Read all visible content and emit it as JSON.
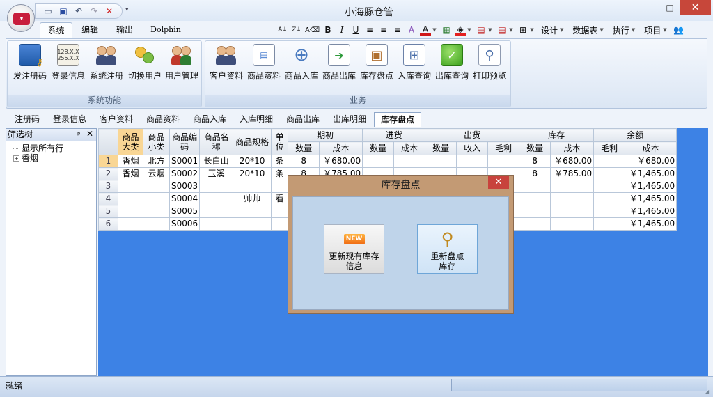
{
  "window": {
    "title": "小海豚仓管",
    "minimize": "–",
    "maximize": "□",
    "close": "✕"
  },
  "qat": {
    "items": [
      "monitor-icon",
      "save-icon",
      "undo-icon",
      "redo-icon",
      "delete-icon"
    ]
  },
  "ribbon_tabs": [
    {
      "label": "系统",
      "active": true
    },
    {
      "label": "编辑",
      "active": false
    },
    {
      "label": "输出",
      "active": false
    },
    {
      "label": "Dolphin",
      "active": false
    }
  ],
  "format_toolbar": {
    "menus": [
      "设计",
      "数据表",
      "执行",
      "项目"
    ]
  },
  "ribbon_groups": [
    {
      "label": "系统功能",
      "buttons": [
        "发注册码",
        "登录信息",
        "系统注册",
        "切换用户",
        "用户管理"
      ]
    },
    {
      "label": "业务",
      "buttons": [
        "客户资料",
        "商品资料",
        "商品入库",
        "商品出库",
        "库存盘点",
        "入库查询",
        "出库查询",
        "打印预览"
      ]
    }
  ],
  "doc_tabs": [
    {
      "label": "注册码",
      "active": false
    },
    {
      "label": "登录信息",
      "active": false
    },
    {
      "label": "客户资料",
      "active": false
    },
    {
      "label": "商品资料",
      "active": false
    },
    {
      "label": "商品入库",
      "active": false
    },
    {
      "label": "入库明细",
      "active": false
    },
    {
      "label": "商品出库",
      "active": false
    },
    {
      "label": "出库明细",
      "active": false
    },
    {
      "label": "库存盘点",
      "active": true
    }
  ],
  "filter_panel": {
    "title": "筛选树",
    "pin": "ᵖ",
    "close": "✕",
    "items": [
      {
        "label": "显示所有行",
        "expandable": false
      },
      {
        "label": "香烟",
        "expandable": true
      }
    ]
  },
  "grid": {
    "group_headers": [
      "期初",
      "进货",
      "出货",
      "库存",
      "余额"
    ],
    "fixed_headers": [
      "商品大类",
      "商品小类",
      "商品编码",
      "商品名称",
      "商品规格",
      "单位"
    ],
    "sub_headers": [
      "数量",
      "成本",
      "数量",
      "成本",
      "数量",
      "收入",
      "毛利",
      "数量",
      "成本",
      "毛利",
      "成本"
    ],
    "rows": [
      {
        "n": "1",
        "big": "香烟",
        "small": "北方",
        "code": "S0001",
        "name": "长白山",
        "spec": "20*10",
        "unit": "条",
        "q0": "8",
        "c0": "￥680.00",
        "q1": "",
        "c1": "",
        "q2": "",
        "inc": "",
        "gp": "",
        "q3": "8",
        "c3": "￥680.00",
        "gp2": "",
        "bal": "￥680.00"
      },
      {
        "n": "2",
        "big": "香烟",
        "small": "云烟",
        "code": "S0002",
        "name": "玉溪",
        "spec": "20*10",
        "unit": "条",
        "q0": "8",
        "c0": "￥785.00",
        "q1": "",
        "c1": "",
        "q2": "",
        "inc": "",
        "gp": "",
        "q3": "8",
        "c3": "￥785.00",
        "gp2": "",
        "bal": "￥1,465.00"
      },
      {
        "n": "3",
        "big": "",
        "small": "",
        "code": "S0003",
        "name": "",
        "spec": "",
        "unit": "",
        "q0": "",
        "c0": "",
        "q1": "",
        "c1": "",
        "q2": "",
        "inc": "",
        "gp": "",
        "q3": "",
        "c3": "",
        "gp2": "",
        "bal": "￥1,465.00"
      },
      {
        "n": "4",
        "big": "",
        "small": "",
        "code": "S0004",
        "name": "",
        "spec": "帅帅",
        "unit": "看",
        "q0": "",
        "c0": "",
        "q1": "",
        "c1": "",
        "q2": "",
        "inc": "",
        "gp": "",
        "q3": "",
        "c3": "",
        "gp2": "",
        "bal": "￥1,465.00"
      },
      {
        "n": "5",
        "big": "",
        "small": "",
        "code": "S0005",
        "name": "",
        "spec": "",
        "unit": "",
        "q0": "",
        "c0": "",
        "q1": "",
        "c1": "",
        "q2": "",
        "inc": "",
        "gp": "",
        "q3": "",
        "c3": "",
        "gp2": "",
        "bal": "￥1,465.00"
      },
      {
        "n": "6",
        "big": "",
        "small": "",
        "code": "S0006",
        "name": "",
        "spec": "",
        "unit": "",
        "q0": "",
        "c0": "",
        "q1": "",
        "c1": "",
        "q2": "",
        "inc": "",
        "gp": "",
        "q3": "",
        "c3": "",
        "gp2": "",
        "bal": "￥1,465.00"
      }
    ]
  },
  "dialog": {
    "title": "库存盘点",
    "close": "✕",
    "btn1_badge": "NEW",
    "btn1_line1": "更新现有库存",
    "btn1_line2": "信息",
    "btn2_line1": "重新盘点",
    "btn2_line2": "库存"
  },
  "status": {
    "text": "就绪"
  }
}
